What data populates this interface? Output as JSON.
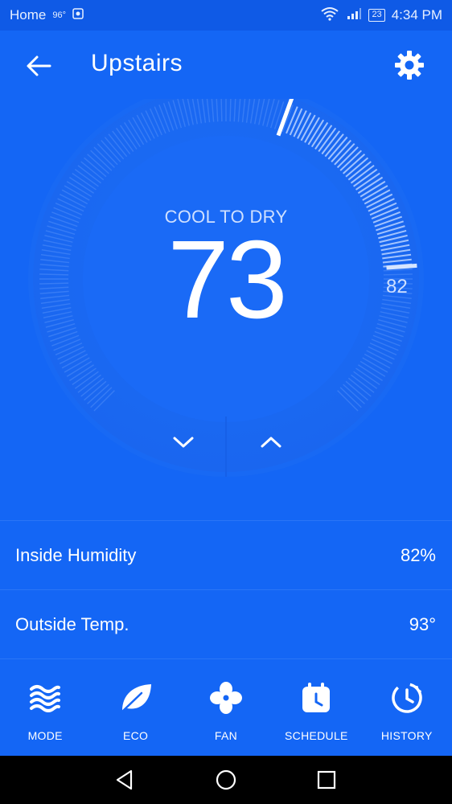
{
  "status_bar": {
    "carrier": "Home",
    "weather": "96°",
    "battery": "23",
    "time": "4:34 PM"
  },
  "header": {
    "title": "Upstairs"
  },
  "thermostat": {
    "mode_label": "COOL TO DRY",
    "current_setpoint": "73",
    "limit_label": "82"
  },
  "info": {
    "humidity_label": "Inside Humidity",
    "humidity_value": "82%",
    "outside_label": "Outside Temp.",
    "outside_value": "93°"
  },
  "nav": [
    {
      "label": "MODE",
      "icon": "waves-icon"
    },
    {
      "label": "ECO",
      "icon": "leaf-icon"
    },
    {
      "label": "FAN",
      "icon": "fan-icon"
    },
    {
      "label": "SCHEDULE",
      "icon": "calendar-clock-icon"
    },
    {
      "label": "HISTORY",
      "icon": "history-icon"
    }
  ],
  "colors": {
    "background": "#1466f5",
    "status_bar": "#0f5ae6",
    "dial": "#1a6cf7",
    "text": "#ffffff"
  }
}
